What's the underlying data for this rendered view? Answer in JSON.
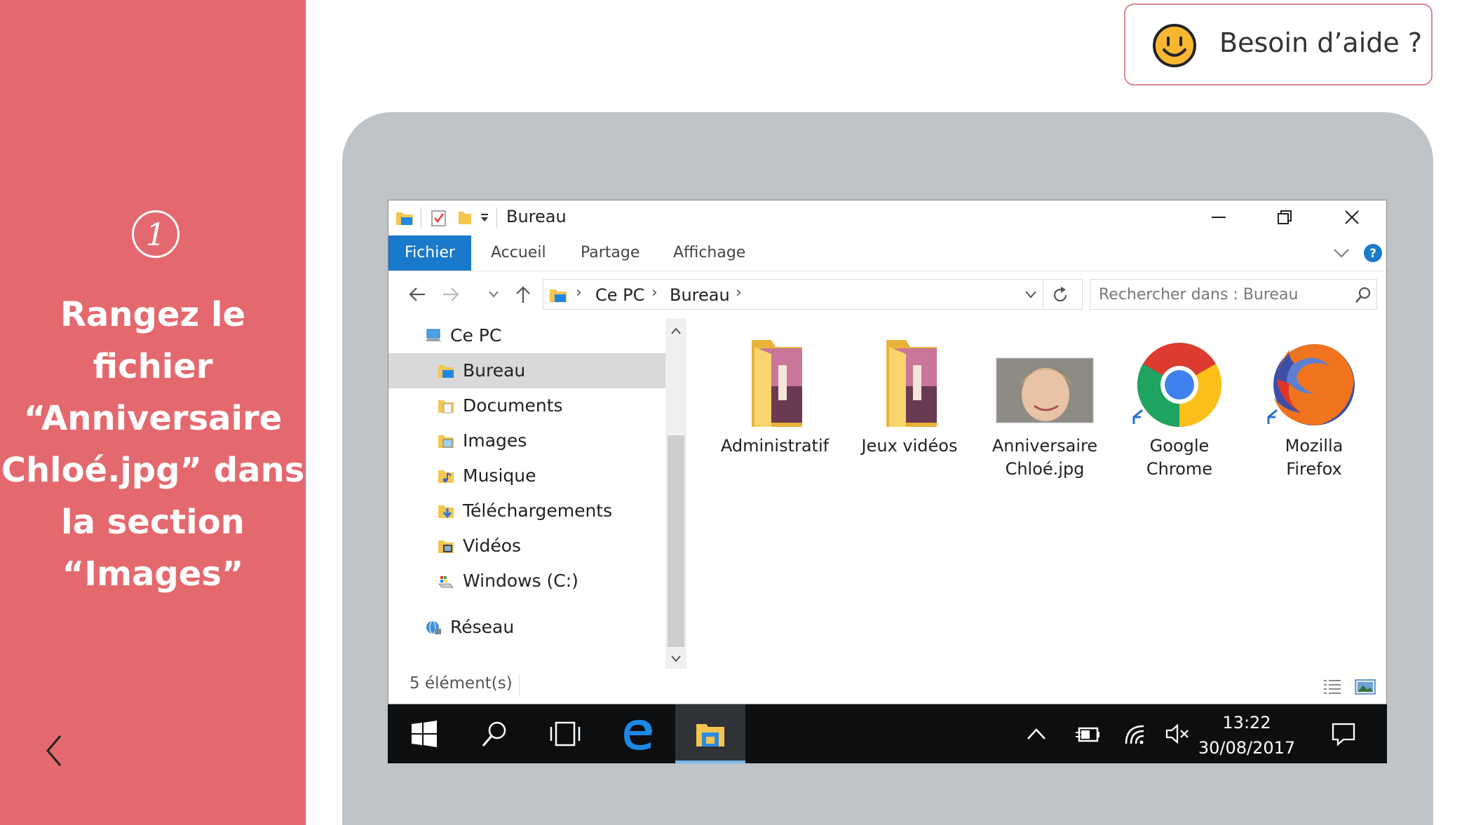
{
  "instruction": {
    "step_number": "1",
    "lines": [
      "Rangez le fichier",
      "“Anniversaire",
      "Chloé.jpg” dans",
      "la section",
      "“Images”"
    ]
  },
  "help": {
    "label": "Besoin d’aide ?"
  },
  "colors": {
    "left_panel": "#e4696e",
    "ribbon_file_tab": "#1979ca",
    "taskbar": "#0c0e10",
    "device_frame": "#bfc4c8"
  },
  "explorer": {
    "title": "Bureau",
    "ribbon_tabs": [
      "Fichier",
      "Accueil",
      "Partage",
      "Affichage"
    ],
    "breadcrumb": [
      "Ce PC",
      "Bureau"
    ],
    "search_placeholder": "Rechercher dans : Bureau",
    "nav": {
      "root": "Ce PC",
      "items": [
        "Bureau",
        "Documents",
        "Images",
        "Musique",
        "Téléchargements",
        "Vidéos",
        "Windows (C:)"
      ],
      "selected": "Bureau",
      "network": "Réseau"
    },
    "files": [
      {
        "name": "Administratif",
        "type": "folder-icon"
      },
      {
        "name": "Jeux vidéos",
        "type": "folder-icon"
      },
      {
        "name": "Anniversaire Chloé.jpg",
        "line1": "Anniversaire",
        "line2": "Chloé.jpg",
        "type": "image-thumbnail"
      },
      {
        "name": "Google Chrome",
        "line1": "Google",
        "line2": "Chrome",
        "type": "chrome-icon"
      },
      {
        "name": "Mozilla Firefox",
        "line1": "Mozilla",
        "line2": "Firefox",
        "type": "firefox-icon"
      }
    ],
    "status": "5 élément(s)"
  },
  "taskbar": {
    "time": "13:22",
    "date": "30/08/2017"
  }
}
